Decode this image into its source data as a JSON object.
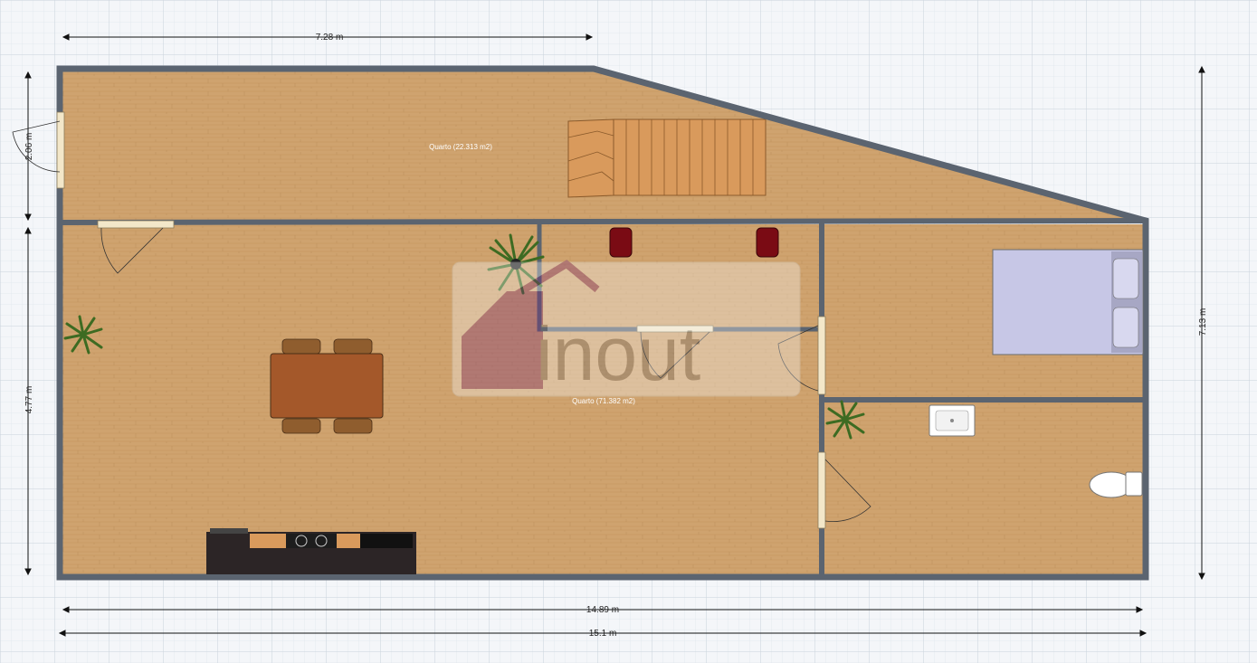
{
  "plan": {
    "rooms": [
      {
        "id": "upper",
        "label": "Quarto (22.313 m2)"
      },
      {
        "id": "lower",
        "label": "Quarto (71.382 m2)"
      }
    ],
    "dimensions": {
      "top": "7.28 m",
      "left_upper": "2.06 m",
      "left_lower": "4.77 m",
      "right": "7.13 m",
      "bottom_inner": "14.89 m",
      "bottom_outer": "15.1 m"
    },
    "watermark": "inout",
    "colors": {
      "floor": "#cfa36f",
      "wall": "#5b6470",
      "grid_bg": "#f4f6f9",
      "grid_line": "#d6dde6",
      "bed": "#c7c7e6",
      "stairs": "#d99a5c",
      "table": "#a4582a",
      "kitchen": "#2c2526",
      "red_chair": "#7a0b14"
    }
  }
}
